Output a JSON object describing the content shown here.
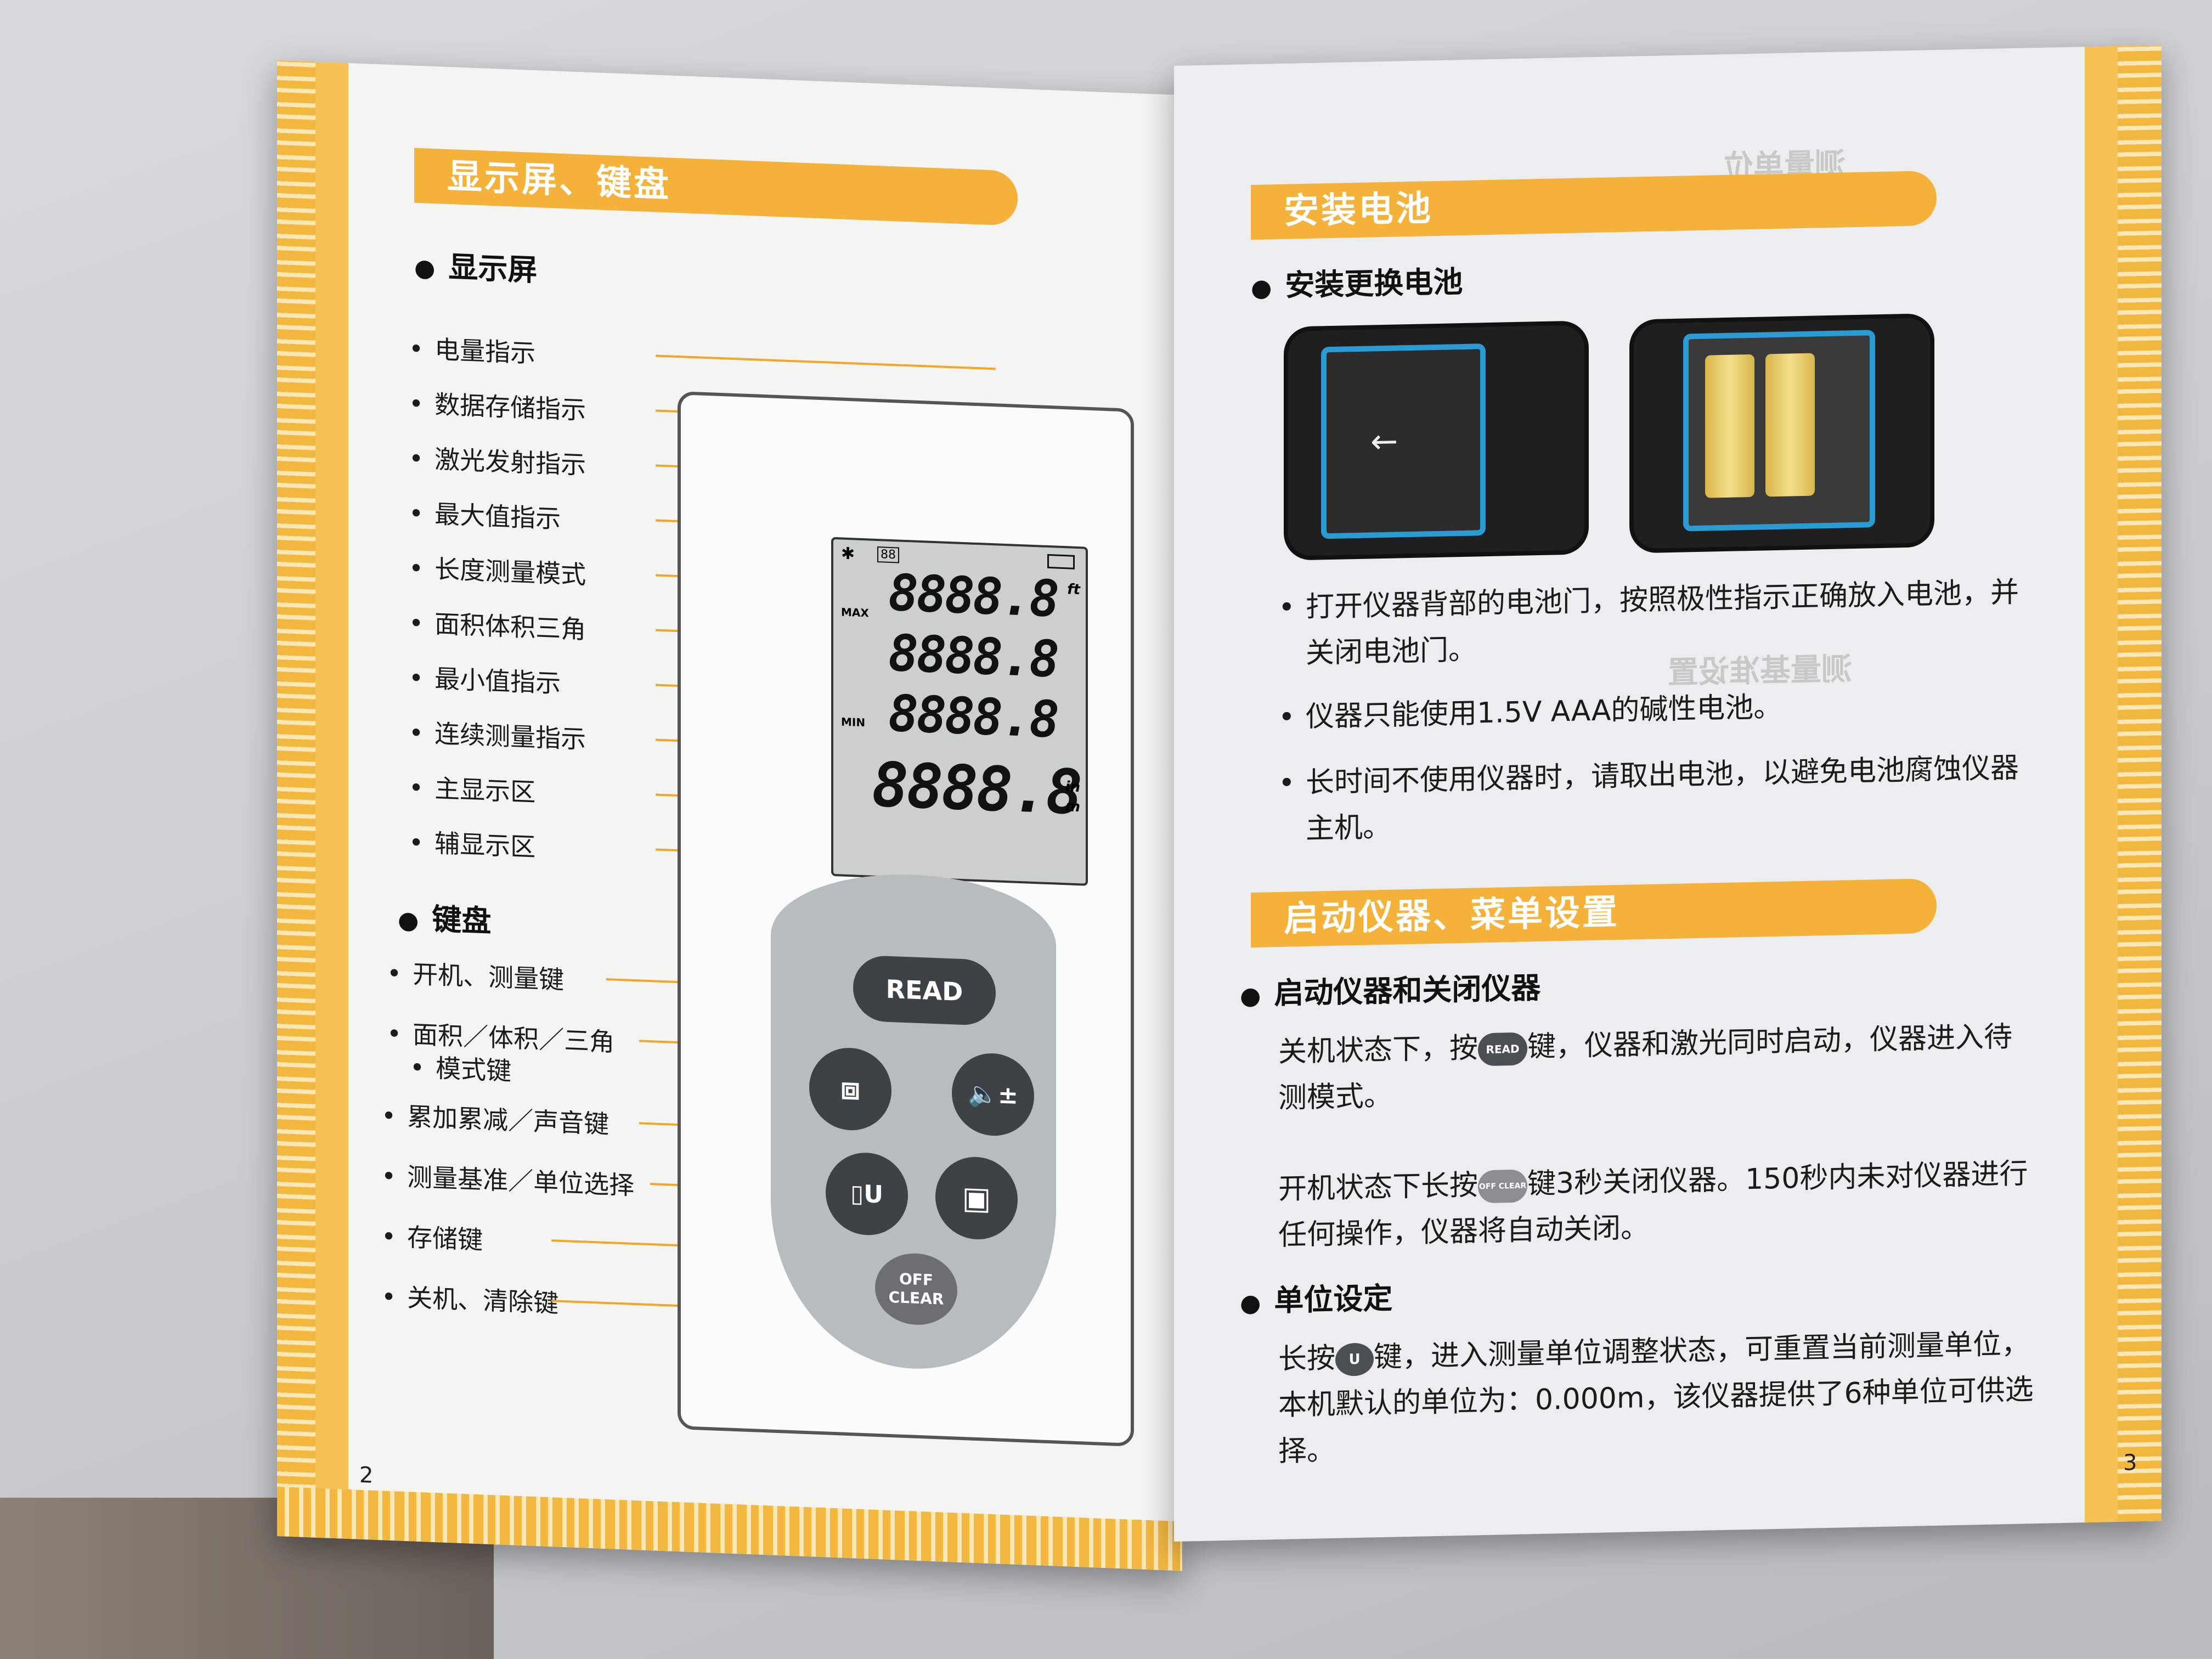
{
  "left_page": {
    "banner": "显示屏、键盘",
    "display_heading": "显示屏",
    "display_labels": [
      "电量指示",
      "数据存储指示",
      "激光发射指示",
      "最大值指示",
      "长度测量模式",
      "面积体积三角",
      "最小值指示",
      "连续测量指示",
      "主显示区",
      "辅显示区"
    ],
    "keypad_heading": "键盘",
    "keypad_labels": [
      "开机、测量键",
      "面积／体积／三角",
      "模式键",
      "累加累减／声音键",
      "测量基准／单位选择",
      "存储键",
      "关机、清除键"
    ],
    "lcd": {
      "row_value": "8888.8",
      "main_value": "8888.8",
      "max_label": "MAX",
      "min_label": "MIN",
      "memory_label": "88",
      "unit_ft": "ft",
      "unit_in": "in",
      "unit_m": "m"
    },
    "keys": {
      "read": "READ",
      "off": "OFF",
      "clear": "CLEAR",
      "volume": "±"
    },
    "page_number": "2"
  },
  "right_page": {
    "banner1": "安装电池",
    "battery_heading": "安装更换电池",
    "battery_bullets": [
      "打开仪器背部的电池门，按照极性指示正确放入电池，并关闭电池门。",
      "仪器只能使用1.5V AAA的碱性电池。",
      "长时间不使用仪器时，请取出电池，以避免电池腐蚀仪器主机。"
    ],
    "banner2": "启动仪器、菜单设置",
    "startup_heading": "启动仪器和关闭仪器",
    "startup_p1_a": "关机状态下，按",
    "startup_p1_b": "键，仪器和激光同时启动，仪器进入待测模式。",
    "startup_p2_a": "开机状态下长按",
    "startup_p2_b": "键3秒关闭仪器。150秒内未对仪器进行任何操作，仪器将自动关闭。",
    "unit_heading": "单位设定",
    "unit_p_a": "长按",
    "unit_p_b": "键，进入测量单位调整状态，可重置当前测量单位，本机默认的单位为：0.000m，该仪器提供了6种单位可供选择。",
    "inline_read": "READ",
    "inline_off": "OFF CLEAR",
    "inline_unit": "U",
    "page_number": "3"
  }
}
